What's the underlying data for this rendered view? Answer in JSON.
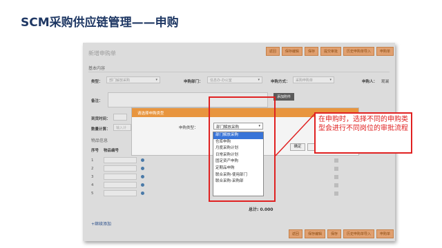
{
  "slide": {
    "title": "SCM采购供应链管理——申购"
  },
  "form": {
    "title": "新增申购单",
    "top_buttons": [
      "返回",
      "保存编辑",
      "保存",
      "提交审批",
      "历史申购单导入",
      "申购单"
    ],
    "bottom_buttons": [
      "返回",
      "保存编辑",
      "保存",
      "历史申购单导入",
      "申购单"
    ],
    "basic_section": "基本内容",
    "type_label": "类型：",
    "type_value": "部门解放采购",
    "dept_label": "申购部门：",
    "dept_value": "信息办-办公室",
    "method_label": "申购方式：",
    "method_value": "采购申购单",
    "applicant_label": "申购人：",
    "applicant_value": "观澜",
    "remark_label": "备注：",
    "upload_button": "添加附件",
    "arrival_label": "到货时间：",
    "quantity_label": "数量计算：",
    "quantity_placeholder": "输入计",
    "goods_section": "物品信息",
    "col_no": "序号",
    "col_code": "物品编号",
    "rows": [
      "1",
      "2",
      "3",
      "4",
      "5"
    ],
    "total_label": "总计: 0.000",
    "add_row_link": "+继续添加"
  },
  "modal": {
    "title": "请选择申购类型",
    "type_label": "申购类型：",
    "selected": "部门解放采购",
    "ok_button": "确定",
    "options": [
      "部门解放采购",
      "仓库申购",
      "月度采购计划",
      "日常采购计划",
      "固定资产申购",
      "定期品申购",
      "联合采购-使用部门",
      "联合采购-采购部"
    ]
  },
  "callout": {
    "text": "在申购时，选择不同的申购类型会进行不同岗位的审批流程"
  },
  "colors": {
    "title": "#1f3864",
    "accent_orange": "#e8953e",
    "highlight_red": "#e02020",
    "selected_blue": "#3874d8"
  }
}
